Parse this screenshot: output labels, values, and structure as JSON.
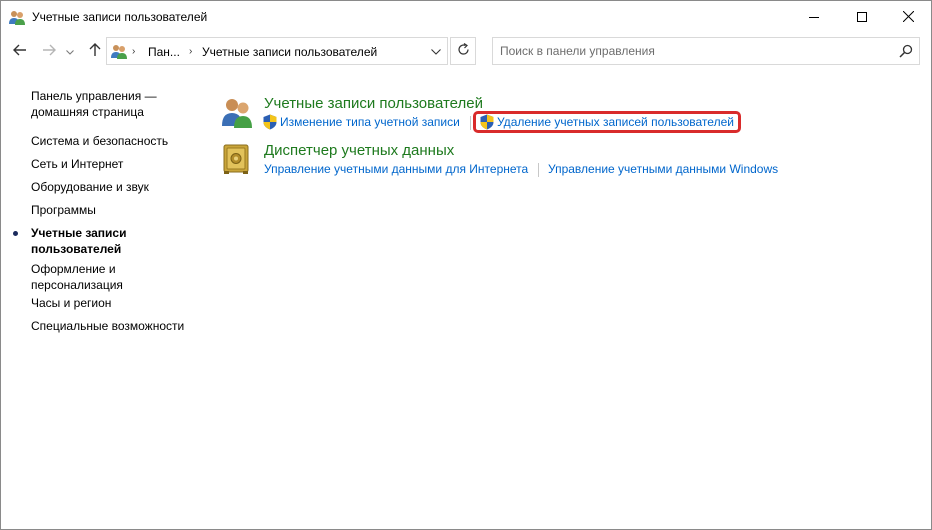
{
  "window": {
    "title": "Учетные записи пользователей",
    "app_icon": "users-icon"
  },
  "caption_buttons": {
    "minimize": "minimize-icon",
    "maximize": "maximize-icon",
    "close": "close-icon"
  },
  "navigation": {
    "back": "arrow-left-icon",
    "forward": "arrow-right-icon",
    "recent": "chevron-down-icon",
    "up": "arrow-up-icon"
  },
  "address": {
    "crumbs": [
      "Пан...",
      "Учетные записи пользователей"
    ],
    "icon": "users-icon"
  },
  "search": {
    "placeholder": "Поиск в панели управления",
    "value": ""
  },
  "sidebar": {
    "home": {
      "line1": "Панель управления —",
      "line2": "домашняя страница"
    },
    "items": [
      {
        "label": "Система и безопасность"
      },
      {
        "label": "Сеть и Интернет"
      },
      {
        "label": "Оборудование и звук"
      },
      {
        "label": "Программы"
      },
      {
        "line1": "Учетные записи",
        "line2": "пользователей",
        "current": true
      },
      {
        "line1": "Оформление и",
        "line2": "персонализация"
      },
      {
        "label": "Часы и регион"
      },
      {
        "label": "Специальные возможности"
      }
    ]
  },
  "main": {
    "sections": [
      {
        "title": "Учетные записи пользователей",
        "icon": "users-icon",
        "links": [
          {
            "label": "Изменение типа учетной записи",
            "icon": "uac-shield-icon"
          },
          {
            "label": "Удаление учетных записей пользователей",
            "icon": "uac-shield-icon",
            "highlighted": true
          }
        ]
      },
      {
        "title": "Диспетчер учетных данных",
        "icon": "credential-vault-icon",
        "links": [
          {
            "label": "Управление учетными данными для Интернета"
          },
          {
            "label": "Управление учетными данными Windows"
          }
        ]
      }
    ]
  },
  "colors": {
    "section_title": "#1e7a1e",
    "link": "#0066cc",
    "highlight_border": "#d92b2b"
  }
}
